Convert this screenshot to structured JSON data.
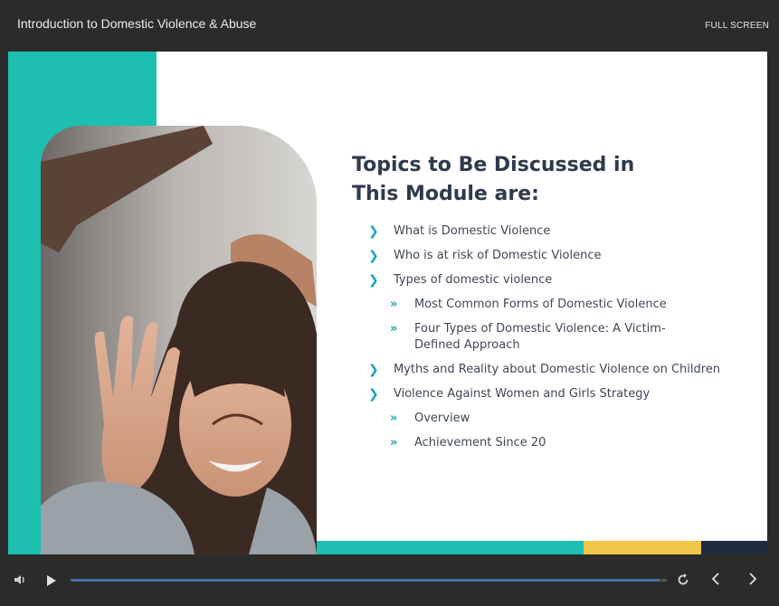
{
  "header": {
    "course_title": "Introduction to Domestic Violence & Abuse",
    "fullscreen_label": "FULL SCREEN"
  },
  "slide": {
    "heading_line1": "Topics to Be Discussed in",
    "heading_line2": "This Module are:",
    "bullet_icons": {
      "level1": "chevron-right-icon",
      "level2": "double-chevron-right-icon"
    },
    "topics": [
      {
        "level": 1,
        "text": "What is Domestic Violence"
      },
      {
        "level": 1,
        "text": "Who is at risk of Domestic Violence"
      },
      {
        "level": 1,
        "text": "Types of domestic violence"
      },
      {
        "level": 2,
        "text": "Most Common Forms of Domestic Violence"
      },
      {
        "level": 2,
        "text": "Four Types of Domestic Violence: A Victim-Defined Approach"
      },
      {
        "level": 1,
        "text": "Myths and Reality about Domestic Violence on Children"
      },
      {
        "level": 1,
        "text": "Violence Against Women and Girls Strategy"
      },
      {
        "level": 2,
        "text": "Overview"
      },
      {
        "level": 2,
        "text": "Achievement Since 20"
      }
    ]
  },
  "player": {
    "progress_fraction": 0.99,
    "icons": [
      "volume-icon",
      "play-icon",
      "replay-icon",
      "previous-icon",
      "next-icon"
    ]
  },
  "colors": {
    "teal": "#1cbfb0",
    "yellow": "#f0c64b",
    "navy": "#1f2b3d",
    "heading": "#2e3a4d",
    "bullet": "#1da3b5",
    "progress": "#4a6fa5"
  }
}
